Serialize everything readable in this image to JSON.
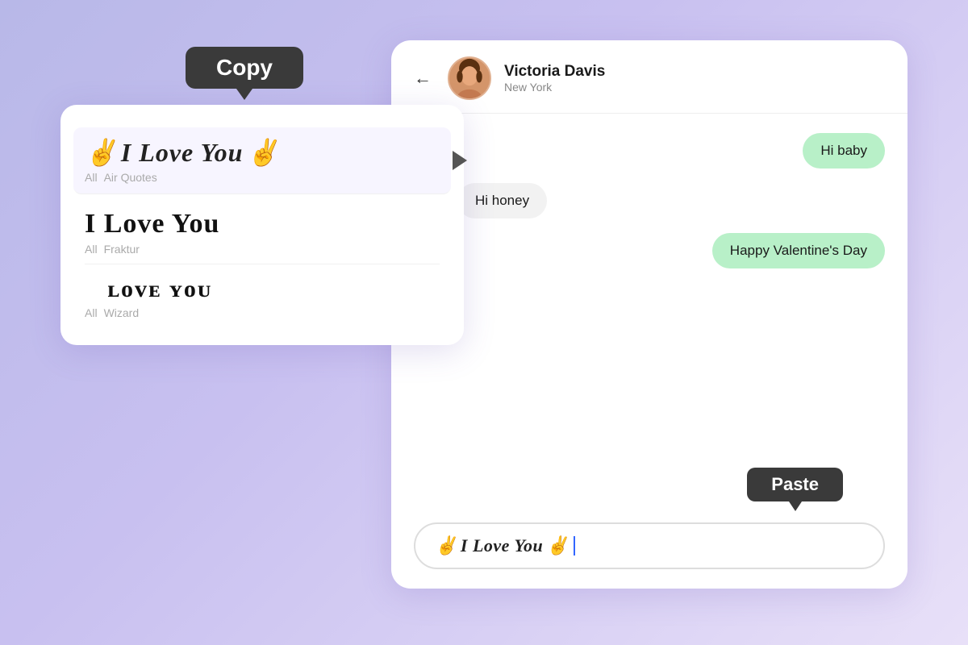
{
  "background": {
    "gradient_start": "#b8b8e8",
    "gradient_end": "#e8e0f8"
  },
  "font_panel": {
    "copy_tooltip": "Copy",
    "items": [
      {
        "id": "air-quotes",
        "text_prefix": "✌️",
        "text_main": "I Love You",
        "text_suffix": "✌️",
        "style": "air-quotes",
        "tags": [
          "All",
          "Air Quotes"
        ],
        "selected": true
      },
      {
        "id": "fraktur",
        "text_main": "I Love You",
        "style": "fraktur",
        "tags": [
          "All",
          "Fraktur"
        ],
        "selected": false
      },
      {
        "id": "wizard",
        "text_main": "ɪ ʟᴏᴠᴇ ʏᴏᴜ",
        "style": "wizard",
        "tags": [
          "All",
          "Wizard"
        ],
        "selected": false
      }
    ]
  },
  "chat": {
    "header": {
      "back_label": "←",
      "contact_name": "Victoria Davis",
      "contact_location": "New York"
    },
    "messages": [
      {
        "id": "msg1",
        "side": "right",
        "text": "Hi baby",
        "style": "green"
      },
      {
        "id": "msg2",
        "side": "left",
        "text": "Hi honey",
        "style": "white"
      },
      {
        "id": "msg3",
        "side": "right",
        "text": "Happy Valentine's Day",
        "style": "green"
      }
    ],
    "paste_tooltip": "Paste",
    "input_text_prefix": "✌️",
    "input_text_main": "I Love You",
    "input_text_suffix": "✌️"
  }
}
